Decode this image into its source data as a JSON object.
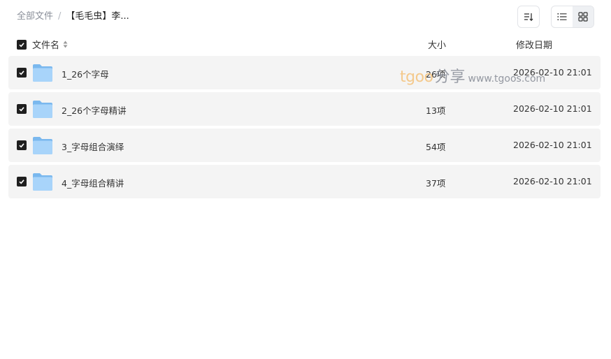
{
  "breadcrumb": {
    "root": "全部文件",
    "separator": "/",
    "current": "【毛毛虫】李..."
  },
  "toolbar": {
    "sort_icon": "sort-icon",
    "list_view_icon": "list-view-icon",
    "grid_view_icon": "grid-view-icon",
    "active_view": "list"
  },
  "table": {
    "headers": {
      "name": "文件名",
      "size": "大小",
      "date": "修改日期"
    },
    "rows": [
      {
        "name": "1_26个字母",
        "size": "26项",
        "date": "2026-02-10 21:01",
        "checked": true
      },
      {
        "name": "2_26个字母精讲",
        "size": "13项",
        "date": "2026-02-10 21:01",
        "checked": true
      },
      {
        "name": "3_字母组合演绎",
        "size": "54项",
        "date": "2026-02-10 21:01",
        "checked": true
      },
      {
        "name": "4_字母组合精讲",
        "size": "37项",
        "date": "2026-02-10 21:01",
        "checked": true
      }
    ]
  },
  "watermark": {
    "latin": "tgoo",
    "cjk": "分享",
    "url": "www.tgoos.com"
  },
  "colors": {
    "row_bg": "#f4f4f4",
    "checkbox": "#1f1f1f",
    "folder": "#8cc7f5"
  }
}
